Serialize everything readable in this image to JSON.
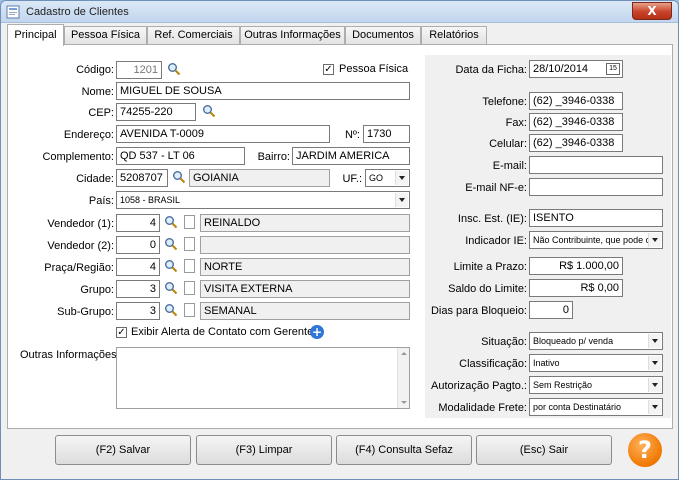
{
  "window": {
    "title": "Cadastro de Clientes",
    "close_label": "X"
  },
  "tabs": [
    "Principal",
    "Pessoa Física",
    "Ref. Comerciais",
    "Outras Informações",
    "Documentos",
    "Relatórios"
  ],
  "left": {
    "codigo": {
      "label": "Código:",
      "value": "1201"
    },
    "pessoa_fisica": {
      "label": "Pessoa Física",
      "checked": "✓"
    },
    "nome": {
      "label": "Nome:",
      "value": "MIGUEL DE SOUSA"
    },
    "cep": {
      "label": "CEP:",
      "value": "74255-220"
    },
    "endereco": {
      "label": "Endereço:",
      "value": "AVENIDA T-0009"
    },
    "numero": {
      "label": "Nº:",
      "value": "1730"
    },
    "complemento": {
      "label": "Complemento:",
      "value": "QD 537 - LT 06"
    },
    "bairro": {
      "label": "Bairro:",
      "value": "JARDIM AMERICA"
    },
    "cidade": {
      "label": "Cidade:",
      "code": "5208707",
      "name": "GOIANIA"
    },
    "uf": {
      "label": "UF.:",
      "value": "GO"
    },
    "pais": {
      "label": "País:",
      "value": "1058 - BRASIL"
    },
    "vendedor1": {
      "label": "Vendedor (1):",
      "code": "4",
      "name": "REINALDO"
    },
    "vendedor2": {
      "label": "Vendedor (2):",
      "code": "0",
      "name": ""
    },
    "praca": {
      "label": "Praça/Região:",
      "code": "4",
      "name": "NORTE"
    },
    "grupo": {
      "label": "Grupo:",
      "code": "3",
      "name": "VISITA EXTERNA"
    },
    "subgrupo": {
      "label": "Sub-Grupo:",
      "code": "3",
      "name": "SEMANAL"
    },
    "alerta": {
      "label": "Exibir Alerta de Contato com Gerente",
      "checked": "✓",
      "plus": "+"
    },
    "outras": {
      "label": "Outras Informações:"
    }
  },
  "right": {
    "data_ficha": {
      "label": "Data da Ficha:",
      "value": "28/10/2014",
      "cal": "15"
    },
    "telefone": {
      "label": "Telefone:",
      "value": "(62) _3946-0338"
    },
    "fax": {
      "label": "Fax:",
      "value": "(62) _3946-0338"
    },
    "celular": {
      "label": "Celular:",
      "value": "(62) _3946-0338"
    },
    "email": {
      "label": "E-mail:",
      "value": ""
    },
    "email_nfe": {
      "label": "E-mail NF-e:",
      "value": ""
    },
    "insc_est": {
      "label": "Insc. Est. (IE):",
      "value": "ISENTO"
    },
    "indicador_ie": {
      "label": "Indicador IE:",
      "value": "Não Contribuinte, que pode ou"
    },
    "limite": {
      "label": "Limite a Prazo:",
      "value": "R$ 1.000,00"
    },
    "saldo": {
      "label": "Saldo do Limite:",
      "value": "R$ 0,00"
    },
    "dias": {
      "label": "Dias para Bloqueio:",
      "value": "0"
    },
    "situacao": {
      "label": "Situação:",
      "value": "Bloqueado p/ venda"
    },
    "classificacao": {
      "label": "Classificação:",
      "value": "Inativo"
    },
    "autorizacao": {
      "label": "Autorização Pagto.:",
      "value": "Sem Restrição"
    },
    "modalidade": {
      "label": "Modalidade Frete:",
      "value": "por conta Destinatário"
    }
  },
  "buttons": {
    "salvar": "(F2) Salvar",
    "limpar": "(F3) Limpar",
    "sefaz": "(F4) Consulta Sefaz",
    "sair": "(Esc) Sair",
    "help": "?"
  }
}
